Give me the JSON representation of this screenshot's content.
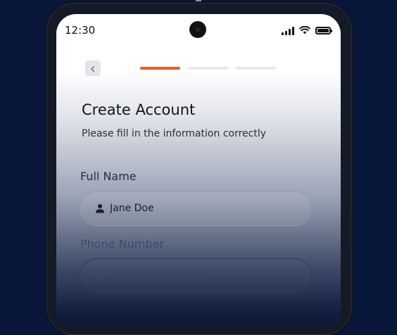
{
  "status_bar": {
    "time": "12:30",
    "icons": [
      "signal-icon",
      "wifi-icon",
      "battery-icon"
    ]
  },
  "header": {
    "back_icon": "chevron-left-icon",
    "progress_steps": 3,
    "active_step": 1
  },
  "form": {
    "title": "Create Account",
    "subtitle": "Please fill in the information correctly",
    "full_name": {
      "label": "Full Name",
      "value": "Jane Doe",
      "icon": "person-icon"
    },
    "phone": {
      "label": "Phone Number",
      "placeholder": "+256 987 656 5210",
      "icon": "phone-icon"
    }
  },
  "colors": {
    "background": "#08163a",
    "accent": "#f05a24",
    "inactive_step": "#e6e8ed",
    "text_dark": "#12151d"
  }
}
